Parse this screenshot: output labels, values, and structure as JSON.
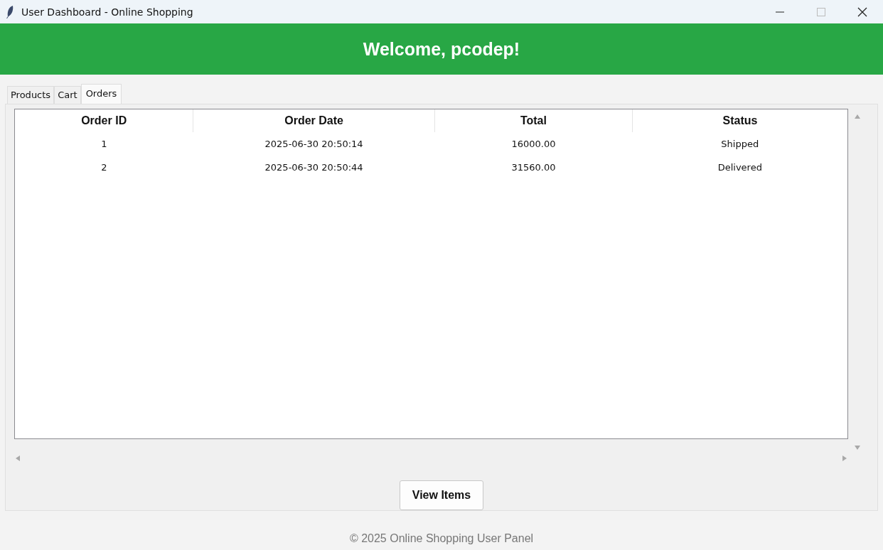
{
  "window": {
    "title": "User Dashboard - Online Shopping"
  },
  "header": {
    "title": "Welcome, pcodep!"
  },
  "tabs": [
    {
      "label": "Products",
      "selected": false
    },
    {
      "label": "Cart",
      "selected": false
    },
    {
      "label": "Orders",
      "selected": true
    }
  ],
  "table": {
    "columns": [
      "Order ID",
      "Order Date",
      "Total",
      "Status"
    ],
    "rows": [
      [
        "1",
        "2025-06-30 20:50:14",
        "16000.00",
        "Shipped"
      ],
      [
        "2",
        "2025-06-30 20:50:44",
        "31560.00",
        "Delivered"
      ]
    ]
  },
  "buttons": [
    "View Items"
  ],
  "footer": "© 2025 Online Shopping User Panel"
}
